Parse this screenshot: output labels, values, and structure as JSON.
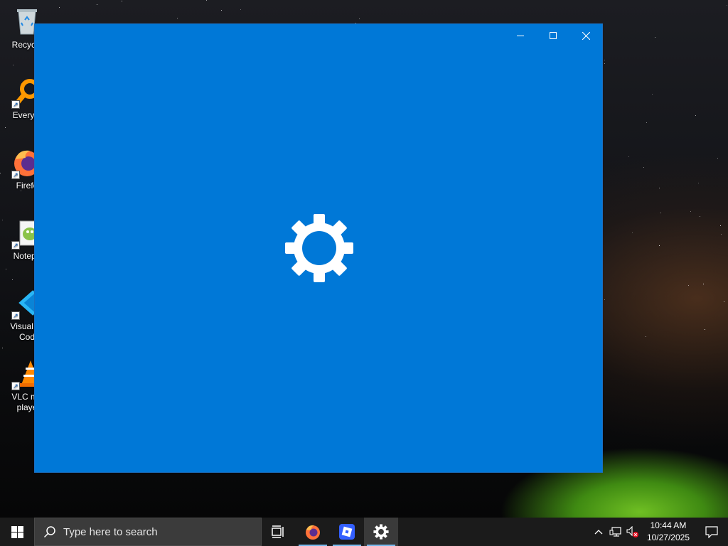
{
  "desktop": {
    "icons": [
      {
        "label": "Recycle",
        "icon": "recycle-bin-icon"
      },
      {
        "label": "Everyth",
        "icon": "everything-search-icon"
      },
      {
        "label": "Firefo",
        "icon": "firefox-icon"
      },
      {
        "label": "Notepa",
        "icon": "notepad-plus-plus-icon"
      },
      {
        "label": "Visual St\nCod",
        "icon": "vscode-icon"
      },
      {
        "label": "VLC me\nplaye",
        "icon": "vlc-icon"
      }
    ]
  },
  "window": {
    "app": "Settings",
    "splash_icon": "gear-icon",
    "background": "#0078d7",
    "controls": {
      "minimize": "minimize-icon",
      "maximize": "maximize-icon",
      "close": "close-icon"
    }
  },
  "taskbar": {
    "search_placeholder": "Type here to search",
    "pinned": [
      {
        "name": "task-view",
        "icon": "task-view-icon"
      },
      {
        "name": "firefox",
        "icon": "firefox-icon",
        "running": true
      },
      {
        "name": "roblox",
        "icon": "roblox-icon",
        "running": true
      },
      {
        "name": "settings",
        "icon": "gear-icon",
        "running": true,
        "active": true
      }
    ],
    "clock": {
      "time": "10:44 AM",
      "date": "10/27/2025"
    },
    "accent": "#76b9ed"
  }
}
